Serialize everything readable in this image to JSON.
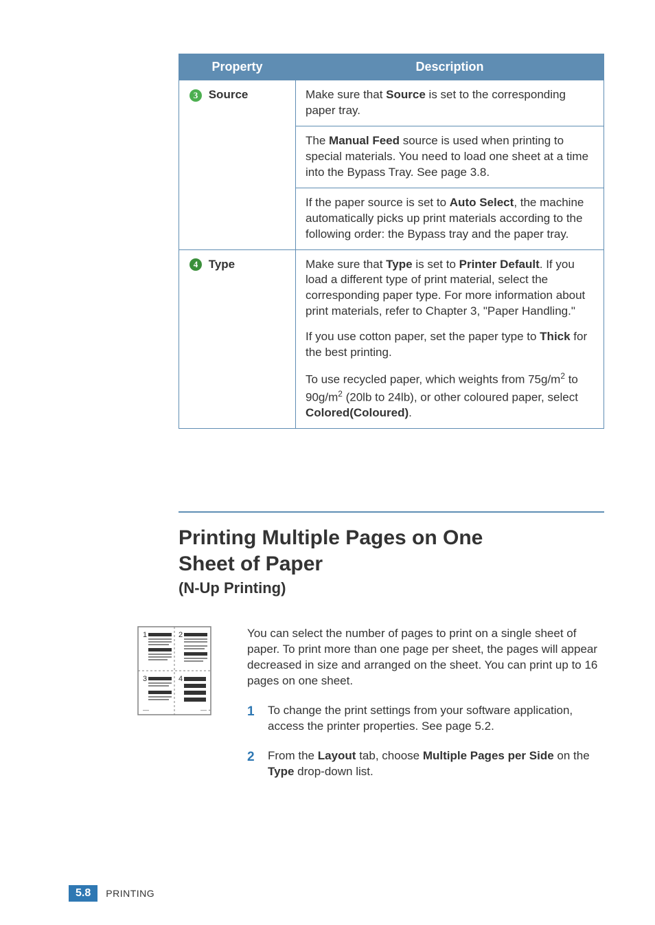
{
  "table": {
    "headers": {
      "property": "Property",
      "description": "Description"
    },
    "rows": [
      {
        "badge_num": "3",
        "badge_color": "#4caf50",
        "label": "Source",
        "cells": [
          {
            "parts": [
              {
                "t": "Make sure that "
              },
              {
                "t": "Source",
                "b": true
              },
              {
                "t": " is set to the corresponding paper tray."
              }
            ]
          },
          {
            "border_top": true,
            "parts": [
              {
                "t": "The "
              },
              {
                "t": "Manual Feed",
                "b": true
              },
              {
                "t": " source is used when printing to special materials. You need to load one sheet at a time into the Bypass Tray. See page 3.8."
              }
            ]
          },
          {
            "border_top": true,
            "parts": [
              {
                "t": "If the paper source is set to "
              },
              {
                "t": "Auto Select",
                "b": true
              },
              {
                "t": ", the machine automatically picks up print materials according to the following order: the Bypass tray and the paper tray."
              }
            ]
          }
        ]
      },
      {
        "badge_num": "4",
        "badge_color": "#3a8f3a",
        "label": "Type",
        "cells": [
          {
            "paragraphs": [
              {
                "parts": [
                  {
                    "t": "Make sure that "
                  },
                  {
                    "t": "Type",
                    "b": true
                  },
                  {
                    "t": " is set to "
                  },
                  {
                    "t": "Printer Default",
                    "b": true
                  },
                  {
                    "t": ". If you load a different type of print material, select the corresponding paper type. For more information about print materials, refer to Chapter 3, \"Paper Handling.\""
                  }
                ]
              },
              {
                "parts": [
                  {
                    "t": "If you use cotton paper, set the paper type to "
                  },
                  {
                    "t": "Thick",
                    "b": true
                  },
                  {
                    "t": " for the best printing."
                  }
                ]
              },
              {
                "parts": [
                  {
                    "t": "To use recycled paper, which weights from 75g/m"
                  },
                  {
                    "t": "2",
                    "sup": true
                  },
                  {
                    "t": "  to 90g/m"
                  },
                  {
                    "t": "2",
                    "sup": true
                  },
                  {
                    "t": "  (20lb to 24lb), or other coloured paper, select "
                  },
                  {
                    "t": "Colored(Coloured)",
                    "b": true
                  },
                  {
                    "t": "."
                  }
                ]
              }
            ]
          }
        ]
      }
    ]
  },
  "section": {
    "title_line1": "Printing Multiple Pages on One",
    "title_line2": "Sheet of Paper",
    "subtitle": "(N-Up Printing)"
  },
  "intro": "You can select the number of pages to print on a single sheet of paper. To print more than one page per sheet, the pages will appear decreased in size and arranged on the sheet. You can print up to 16 pages on one sheet.",
  "steps": [
    {
      "num": "1",
      "parts": [
        {
          "t": "To change the print settings from your software application, access the printer properties. See page 5.2."
        }
      ]
    },
    {
      "num": "2",
      "parts": [
        {
          "t": "From the "
        },
        {
          "t": "Layout",
          "b": true
        },
        {
          "t": " tab, choose "
        },
        {
          "t": "Multiple Pages per Side",
          "b": true
        },
        {
          "t": " on the "
        },
        {
          "t": "Type",
          "b": true
        },
        {
          "t": " drop-down list."
        }
      ]
    }
  ],
  "thumb_nums": [
    "1",
    "2",
    "3",
    "4"
  ],
  "footer": {
    "page": "5.8",
    "label_first": "P",
    "label_rest": "RINTING"
  }
}
